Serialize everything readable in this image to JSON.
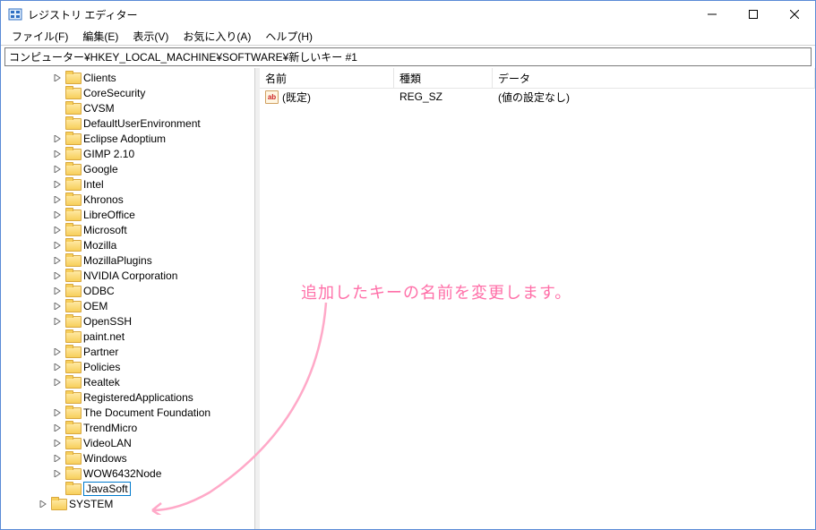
{
  "window": {
    "title": "レジストリ エディター"
  },
  "menu": {
    "file": "ファイル(F)",
    "edit": "編集(E)",
    "view": "表示(V)",
    "favorites": "お気に入り(A)",
    "help": "ヘルプ(H)"
  },
  "address": "コンピューター¥HKEY_LOCAL_MACHINE¥SOFTWARE¥新しいキー #1",
  "tree": {
    "indent_base": 54,
    "items": [
      {
        "label": "Clients",
        "expandable": true,
        "indent": 54
      },
      {
        "label": "CoreSecurity",
        "expandable": false,
        "indent": 54
      },
      {
        "label": "CVSM",
        "expandable": false,
        "indent": 54
      },
      {
        "label": "DefaultUserEnvironment",
        "expandable": false,
        "indent": 54
      },
      {
        "label": "Eclipse Adoptium",
        "expandable": true,
        "indent": 54
      },
      {
        "label": "GIMP 2.10",
        "expandable": true,
        "indent": 54
      },
      {
        "label": "Google",
        "expandable": true,
        "indent": 54
      },
      {
        "label": "Intel",
        "expandable": true,
        "indent": 54
      },
      {
        "label": "Khronos",
        "expandable": true,
        "indent": 54
      },
      {
        "label": "LibreOffice",
        "expandable": true,
        "indent": 54
      },
      {
        "label": "Microsoft",
        "expandable": true,
        "indent": 54
      },
      {
        "label": "Mozilla",
        "expandable": true,
        "indent": 54
      },
      {
        "label": "MozillaPlugins",
        "expandable": true,
        "indent": 54
      },
      {
        "label": "NVIDIA Corporation",
        "expandable": true,
        "indent": 54
      },
      {
        "label": "ODBC",
        "expandable": true,
        "indent": 54
      },
      {
        "label": "OEM",
        "expandable": true,
        "indent": 54
      },
      {
        "label": "OpenSSH",
        "expandable": true,
        "indent": 54
      },
      {
        "label": "paint.net",
        "expandable": false,
        "indent": 54
      },
      {
        "label": "Partner",
        "expandable": true,
        "indent": 54
      },
      {
        "label": "Policies",
        "expandable": true,
        "indent": 54
      },
      {
        "label": "Realtek",
        "expandable": true,
        "indent": 54
      },
      {
        "label": "RegisteredApplications",
        "expandable": false,
        "indent": 54
      },
      {
        "label": "The Document Foundation",
        "expandable": true,
        "indent": 54
      },
      {
        "label": "TrendMicro",
        "expandable": true,
        "indent": 54
      },
      {
        "label": "VideoLAN",
        "expandable": true,
        "indent": 54
      },
      {
        "label": "Windows",
        "expandable": true,
        "indent": 54
      },
      {
        "label": "WOW6432Node",
        "expandable": true,
        "indent": 54
      },
      {
        "label": "JavaSoft",
        "expandable": false,
        "indent": 54,
        "editing": true
      },
      {
        "label": "SYSTEM",
        "expandable": true,
        "indent": 38,
        "cut": true
      }
    ]
  },
  "list": {
    "columns": {
      "name": "名前",
      "type": "種類",
      "data": "データ"
    },
    "col_widths": {
      "name": 150,
      "type": 110,
      "data": 300
    },
    "rows": [
      {
        "name": "(既定)",
        "type": "REG_SZ",
        "data": "(値の設定なし)",
        "icon": "ab"
      }
    ]
  },
  "annotation": {
    "text": "追加したキーの名前を変更します。"
  }
}
